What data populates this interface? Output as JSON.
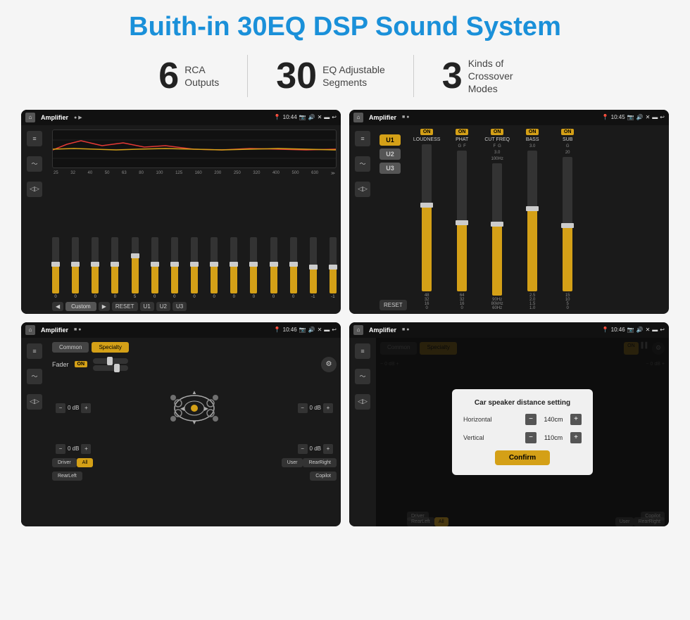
{
  "page": {
    "title": "Buith-in 30EQ DSP Sound System",
    "background_color": "#f5f5f5",
    "title_color": "#1a90d9"
  },
  "stats": [
    {
      "number": "6",
      "label": "RCA\nOutputs"
    },
    {
      "number": "30",
      "label": "EQ Adjustable\nSegments"
    },
    {
      "number": "3",
      "label": "Kinds of\nCrossover Modes"
    }
  ],
  "screens": [
    {
      "id": "screen1",
      "statusbar": {
        "left": "Amplifier",
        "time": "10:44"
      },
      "type": "eq"
    },
    {
      "id": "screen2",
      "statusbar": {
        "left": "Amplifier",
        "time": "10:45"
      },
      "type": "amp"
    },
    {
      "id": "screen3",
      "statusbar": {
        "left": "Amplifier",
        "time": "10:46"
      },
      "type": "fader"
    },
    {
      "id": "screen4",
      "statusbar": {
        "left": "Amplifier",
        "time": "10:46"
      },
      "type": "speaker-distance"
    }
  ],
  "eq": {
    "freq_labels": [
      "25",
      "32",
      "40",
      "50",
      "63",
      "80",
      "100",
      "125",
      "160",
      "200",
      "250",
      "320",
      "400",
      "500",
      "630"
    ],
    "values": [
      "0",
      "0",
      "0",
      "0",
      "5",
      "0",
      "0",
      "0",
      "0",
      "0",
      "0",
      "0",
      "0",
      "-1",
      "0",
      "-1"
    ],
    "preset": "Custom",
    "buttons": [
      "RESET",
      "U1",
      "U2",
      "U3"
    ]
  },
  "amp": {
    "u_buttons": [
      "U1",
      "U2",
      "U3"
    ],
    "channels": [
      {
        "name": "LOUDNESS",
        "on": true
      },
      {
        "name": "PHAT",
        "on": true
      },
      {
        "name": "CUT FREQ",
        "on": true
      },
      {
        "name": "BASS",
        "on": true
      },
      {
        "name": "SUB",
        "on": true
      }
    ],
    "reset": "RESET"
  },
  "fader": {
    "tabs": [
      "Common",
      "Specialty"
    ],
    "active_tab": "Specialty",
    "fader_label": "Fader",
    "fader_on": "ON",
    "db_values": [
      "0 dB",
      "0 dB",
      "0 dB",
      "0 dB"
    ],
    "bottom_buttons": [
      "Driver",
      "All",
      "User",
      "RearRight",
      "RearLeft",
      "Copilot"
    ]
  },
  "speaker_distance": {
    "dialog": {
      "title": "Car speaker distance setting",
      "horizontal_label": "Horizontal",
      "horizontal_value": "140cm",
      "vertical_label": "Vertical",
      "vertical_value": "110cm",
      "confirm_label": "Confirm"
    },
    "db_values": [
      "0 dB",
      "0 dB"
    ],
    "bottom_buttons": [
      "Driver",
      "All",
      "User",
      "RearRight",
      "RearLeft",
      "Copilot"
    ]
  }
}
